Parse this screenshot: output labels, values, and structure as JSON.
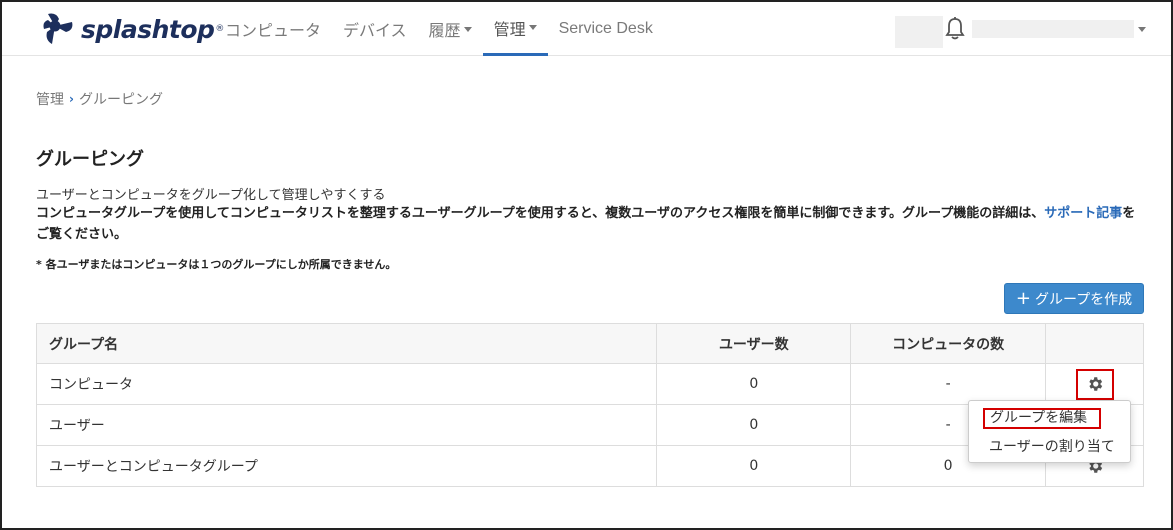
{
  "header": {
    "logo_text": "splashtop",
    "logo_reg": "®",
    "nav": [
      {
        "label": "コンピュータ",
        "dropdown": false,
        "active": false
      },
      {
        "label": "デバイス",
        "dropdown": false,
        "active": false
      },
      {
        "label": "履歴",
        "dropdown": true,
        "active": false
      },
      {
        "label": "管理",
        "dropdown": true,
        "active": true
      },
      {
        "label": "Service Desk",
        "dropdown": false,
        "active": false
      }
    ],
    "icons": {
      "bell": "bell-icon"
    }
  },
  "breadcrumb": {
    "parent": "管理",
    "current": "グルーピング"
  },
  "page": {
    "title": "グルーピング",
    "desc1": "ユーザーとコンピュータをグループ化して管理しやすくする",
    "desc2": "コンピュータグループを使用してコンピュータリストを整理するユーザーグループを使用すると、複数ユーザのアクセス権限を簡単に制御できます。グループ機能の詳細は、",
    "desc2_link": "サポート記事",
    "desc2_end": "をご覧ください。",
    "note": "* 各ユーザまたはコンピュータは１つのグループにしか所属できません。",
    "create_button": "グループを作成"
  },
  "table": {
    "headers": {
      "name": "グループ名",
      "users": "ユーザー数",
      "computers": "コンピュータの数"
    },
    "rows": [
      {
        "name": "コンピュータ",
        "users": "0",
        "computers": "-"
      },
      {
        "name": "ユーザー",
        "users": "0",
        "computers": "-"
      },
      {
        "name": "ユーザーとコンピュータグループ",
        "users": "0",
        "computers": "0"
      }
    ]
  },
  "dropdown": {
    "edit": "グループを編集",
    "assign": "ユーザーの割り当て"
  },
  "colors": {
    "accent": "#2a6ab8",
    "button": "#3d89cc",
    "highlight": "#d40000"
  }
}
